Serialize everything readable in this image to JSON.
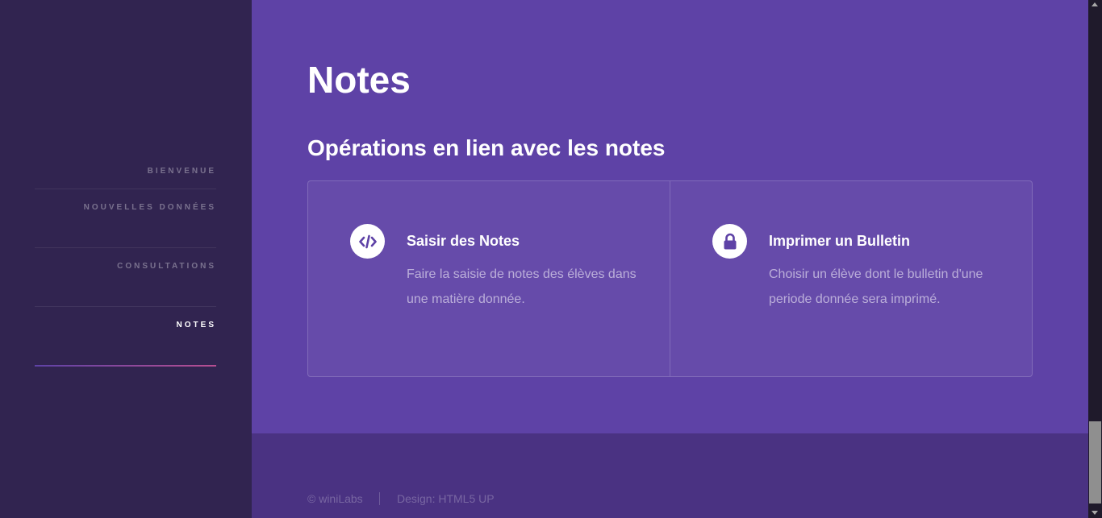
{
  "sidebar": {
    "items": [
      {
        "label": "Bienvenue",
        "active": false
      },
      {
        "label": "Nouvelles données",
        "active": false
      },
      {
        "label": "Consultations",
        "active": false
      },
      {
        "label": "Notes",
        "active": true
      }
    ]
  },
  "main": {
    "title": "Notes",
    "section_title": "Opérations en lien avec les notes",
    "features": [
      {
        "icon": "code-icon",
        "title": "Saisir des Notes",
        "description": "Faire la saisie de notes des élèves dans une matière donnée."
      },
      {
        "icon": "lock-icon",
        "title": "Imprimer un Bulletin",
        "description": "Choisir un élève dont le bulletin d'une periode donnée sera imprimé."
      }
    ]
  },
  "footer": {
    "copyright": "© winiLabs",
    "credit": "Design: HTML5 UP"
  },
  "colors": {
    "sidebar_bg": "#312450",
    "main_bg": "#5e42a6",
    "footer_bg": "#4a3282",
    "accent_gradient_start": "#5e42a6",
    "accent_gradient_end": "#b74e91"
  }
}
